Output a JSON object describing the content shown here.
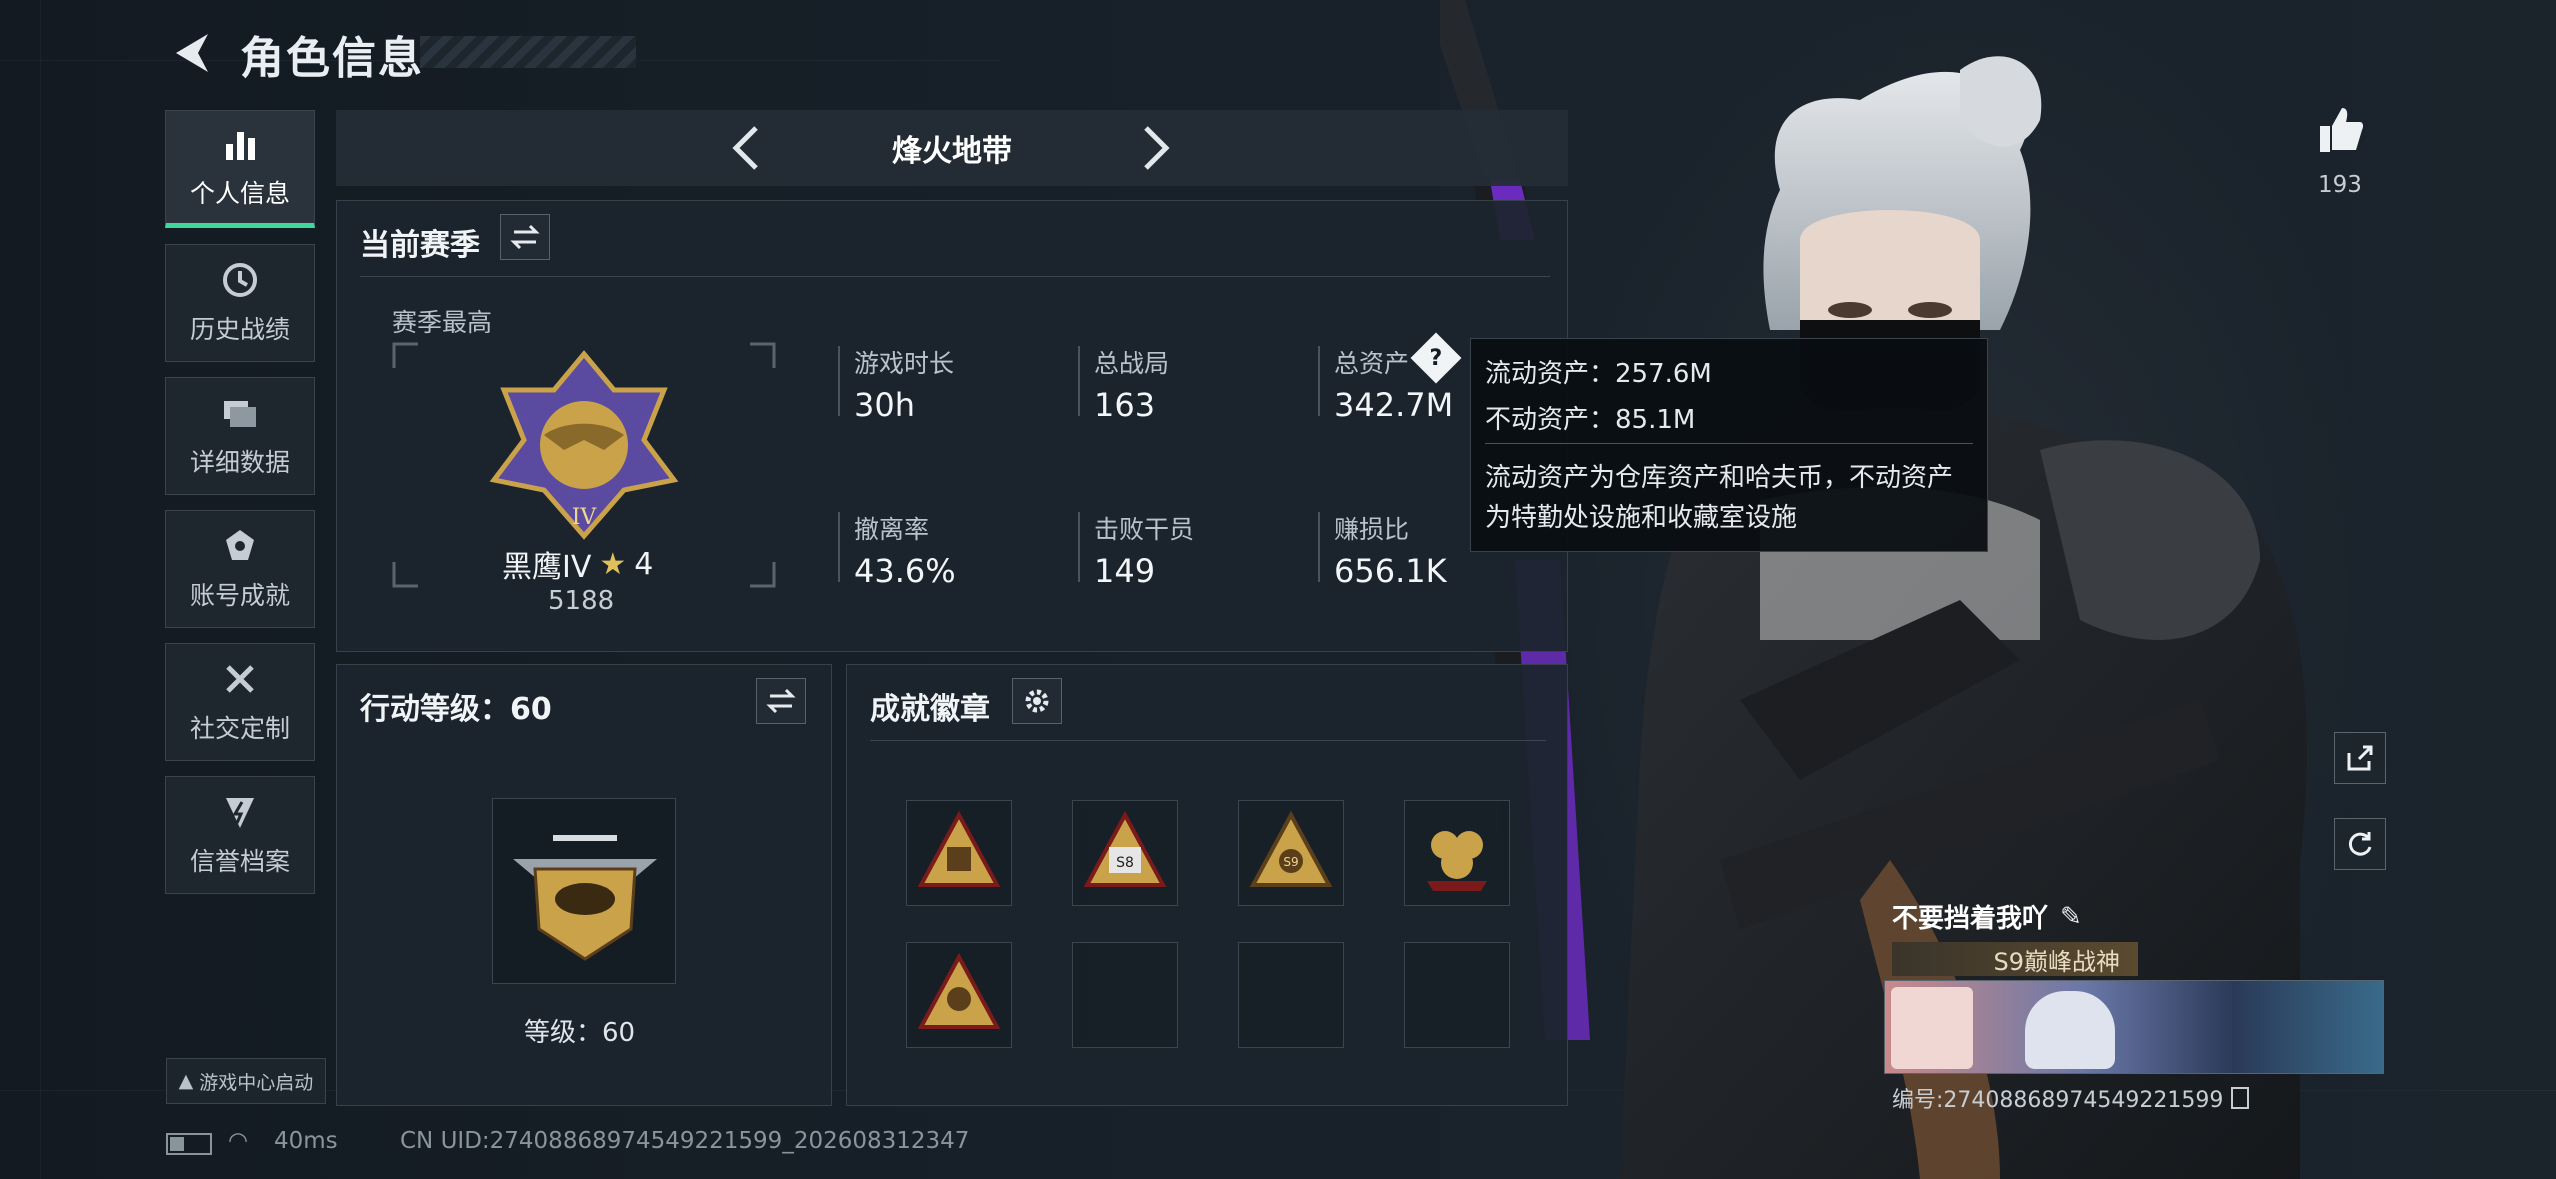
{
  "header": {
    "title": "角色信息"
  },
  "sidebar": {
    "items": [
      {
        "label": "个人信息",
        "active": true
      },
      {
        "label": "历史战绩"
      },
      {
        "label": "详细数据"
      },
      {
        "label": "账号成就"
      },
      {
        "label": "社交定制"
      },
      {
        "label": "信誉档案"
      }
    ]
  },
  "game_center": {
    "label": "游戏中心启动"
  },
  "mode_selector": {
    "name": "烽火地带"
  },
  "season": {
    "title": "当前赛季",
    "best_label": "赛季最高",
    "rank_name": "黑鹰IV",
    "rank_stars": "4",
    "rank_score": "5188",
    "stats": [
      {
        "label": "游戏时长",
        "value": "30h"
      },
      {
        "label": "总战局",
        "value": "163"
      },
      {
        "label": "总资产",
        "value": "342.7M"
      },
      {
        "label": "撤离率",
        "value": "43.6%"
      },
      {
        "label": "击败干员",
        "value": "149"
      },
      {
        "label": "赚损比",
        "value": "656.1K"
      }
    ]
  },
  "tooltip": {
    "liquid": "流动资产：257.6M",
    "fixed": "不动资产：85.1M",
    "desc1": "流动资产为仓库资产和哈夫币，不动资产",
    "desc2": "为特勤处设施和收藏室设施"
  },
  "action_level": {
    "title": "行动等级：60",
    "level_text": "等级：60"
  },
  "badges": {
    "title": "成就徽章",
    "items": [
      {
        "icon": "badge-triangle-1"
      },
      {
        "icon": "badge-s8"
      },
      {
        "icon": "badge-s9"
      },
      {
        "icon": "badge-s10"
      },
      {
        "icon": "badge-triangle-2"
      },
      {
        "icon": "empty"
      },
      {
        "icon": "empty"
      },
      {
        "icon": "empty"
      }
    ]
  },
  "likes": {
    "count": "193"
  },
  "player": {
    "name": "不要挡着我吖",
    "title": "S9巅峰战神",
    "id": "编号:2740886897454922​1599"
  },
  "status_bar": {
    "ping": "40ms",
    "uid": "CN UID:27408868974549221599_202608312347"
  },
  "colors": {
    "accent": "#3fd79a",
    "bg": "#141b22",
    "gold": "#c9a24a"
  }
}
